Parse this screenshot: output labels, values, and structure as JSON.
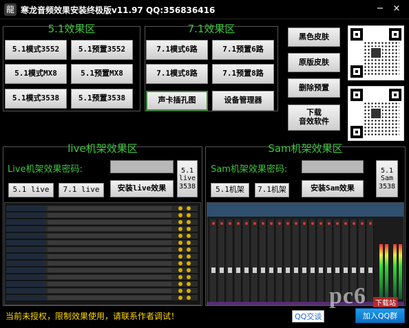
{
  "window": {
    "title": "寒龙音频效果安装终极版v11.97 QQ:356836416",
    "minimize_glyph": "−",
    "close_glyph": "×"
  },
  "section_51": {
    "title": "5.1效果区",
    "buttons": [
      "5.1模式3552",
      "5.1预置3552",
      "5.1模式MX8",
      "5.1预置MX8",
      "5.1模式3538",
      "5.1预置3538"
    ]
  },
  "section_71": {
    "title": "7.1效果区",
    "buttons": [
      "7.1模式6路",
      "7.1预置6路",
      "7.1模式8路",
      "7.1预置8路",
      "声卡插孔图",
      "设备管理器"
    ]
  },
  "right_buttons": [
    "黑色皮肤",
    "原版皮肤",
    "删除预置",
    "下载\n音效软件"
  ],
  "live_section": {
    "title": "live机架效果区",
    "password_label": "Live机架效果密码:",
    "btn_51": "5.1 live",
    "btn_71": "7.1 live",
    "install": "安装live效果",
    "side": "5.1\nlive\n3538"
  },
  "sam_section": {
    "title": "Sam机架效果区",
    "password_label": "Sam机架效果密码:",
    "btn_51": "5.1机架",
    "btn_71": "7.1机架",
    "install": "安装Sam效果",
    "side": "5.1\nSam\n3538"
  },
  "status": {
    "text": "当前未授权，限制效果使用，请联系作者调试！",
    "qq": "QQ交谈",
    "join": "加入QQ群"
  },
  "watermark": {
    "brand": "pc6",
    "sub": "下载站"
  },
  "icons": {
    "app": "dragon-app-icon",
    "qr1": "qr-code-icon",
    "qr2": "qr-code-icon"
  }
}
